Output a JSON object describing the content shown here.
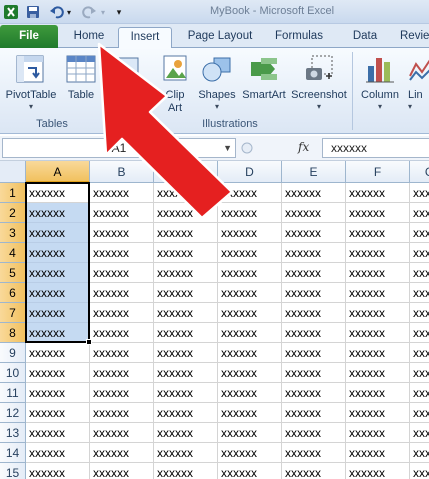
{
  "window": {
    "title": "MyBook - Microsoft Excel"
  },
  "qat": {
    "icons": [
      "excel-logo-icon",
      "save-icon",
      "undo-icon",
      "redo-icon",
      "customize-qat-icon"
    ]
  },
  "tabs": [
    {
      "label": "File"
    },
    {
      "label": "Home"
    },
    {
      "label": "Insert"
    },
    {
      "label": "Page Layout"
    },
    {
      "label": "Formulas"
    },
    {
      "label": "Data"
    },
    {
      "label": "Revie"
    }
  ],
  "ribbon": {
    "groups": [
      {
        "label": "Tables"
      },
      {
        "label": "Illustrations"
      }
    ],
    "buttons": {
      "pivottable": "PivotTable",
      "table": "Table",
      "clipart_line1": "Clip",
      "clipart_line2": "Art",
      "shapes": "Shapes",
      "smartart": "SmartArt",
      "screenshot": "Screenshot",
      "column": "Column",
      "line": "Lin"
    }
  },
  "formula_bar": {
    "name_box": "A1",
    "fx": "fx",
    "value": "xxxxxx"
  },
  "columns": [
    "A",
    "B",
    "C",
    "D",
    "E",
    "F",
    "G"
  ],
  "rows": [
    "1",
    "2",
    "3",
    "4",
    "5",
    "6",
    "7",
    "8",
    "9",
    "10",
    "11",
    "12",
    "13",
    "14",
    "15"
  ],
  "cell_text": "xxxxxx",
  "selection": {
    "range": "A1:A8",
    "active": "A1"
  },
  "colors": {
    "selection": "#c5daf2",
    "header_selected": "#f1c15f",
    "file_tab": "#2a8a34",
    "arrow": "#e52020"
  }
}
